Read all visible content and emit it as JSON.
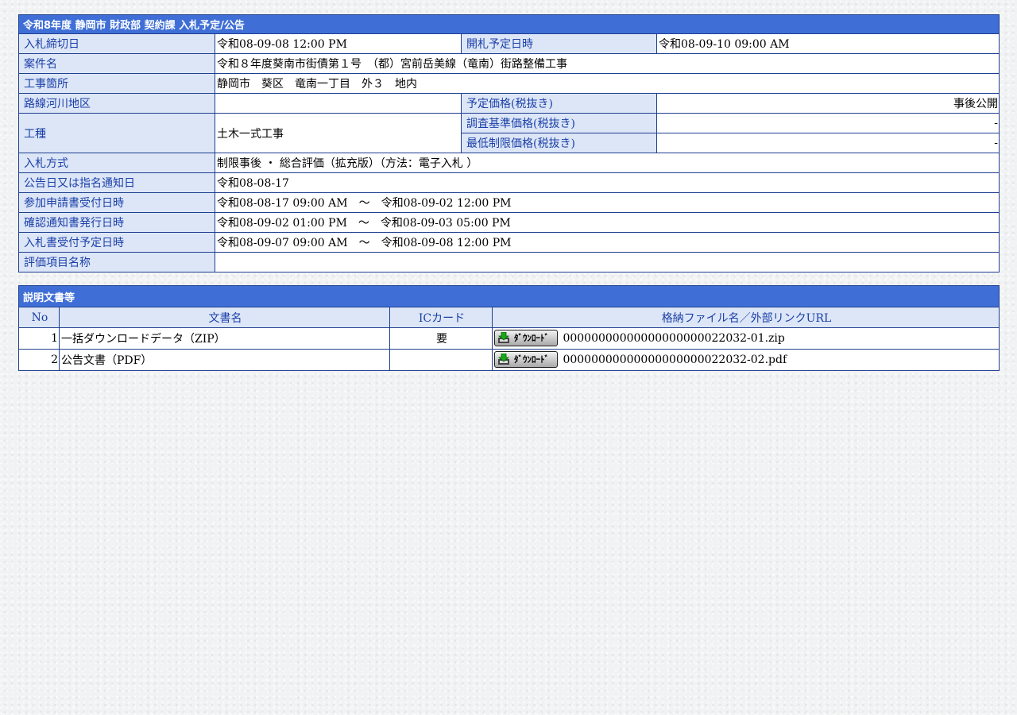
{
  "header": {
    "title": "令和8年度 静岡市 財政部 契約課 入札予定/公告"
  },
  "details": {
    "deadline_label": "入札締切日",
    "deadline_value": "令和08-09-08 12:00 PM",
    "opening_label": "開札予定日時",
    "opening_value": "令和08-09-10 09:00 AM",
    "project_label": "案件名",
    "project_value": "令和８年度葵南市街債第１号　（都）宮前岳美線（竜南）街路整備工事",
    "location_label": "工事箇所",
    "location_value": "静岡市　葵区　竜南一丁目　外３　地内",
    "route_label": "路線河川地区",
    "route_value": "",
    "planned_price_label": "予定価格(税抜き)",
    "planned_price_value": "事後公開",
    "work_type_label": "工種",
    "work_type_value": "土木一式工事",
    "survey_price_label": "調査基準価格(税抜き)",
    "survey_price_value": "-",
    "min_price_label": "最低制限価格(税抜き)",
    "min_price_value": "-",
    "method_label": "入札方式",
    "method_value": "制限事後 ・ 総合評価（拡充版）（方法：電子入札 ）",
    "notice_date_label": "公告日又は指名通知日",
    "notice_date_value": "令和08-08-17",
    "application_label": "参加申請書受付日時",
    "application_value": "令和08-08-17 09:00 AM　～　令和08-09-02 12:00 PM",
    "confirmation_label": "確認通知書発行日時",
    "confirmation_value": "令和08-09-02 01:00 PM　～　令和08-09-03 05:00 PM",
    "bid_accept_label": "入札書受付予定日時",
    "bid_accept_value": "令和08-09-07 09:00 AM　～　令和08-09-08 12:00 PM",
    "evaluation_label": "評価項目名称",
    "evaluation_value": ""
  },
  "documents": {
    "title": "説明文書等",
    "columns": [
      "No",
      "文書名",
      "ICカード",
      "格納ファイル名／外部リンクURL"
    ],
    "download_label": "ﾀﾞｳﾝﾛｰﾄﾞ",
    "rows": [
      {
        "no": "1",
        "name": "一括ダウンロードデータ（ZIP）",
        "ic_card": "要",
        "file": "00000000000000000000022032-01.zip"
      },
      {
        "no": "2",
        "name": "公告文書（PDF）",
        "ic_card": "",
        "file": "00000000000000000000022032-02.pdf"
      }
    ]
  },
  "colors": {
    "header_bg": "#3f6fd6",
    "label_bg": "#dce6f7",
    "label_text": "#1b3fa8",
    "border": "#1f3f8f"
  }
}
